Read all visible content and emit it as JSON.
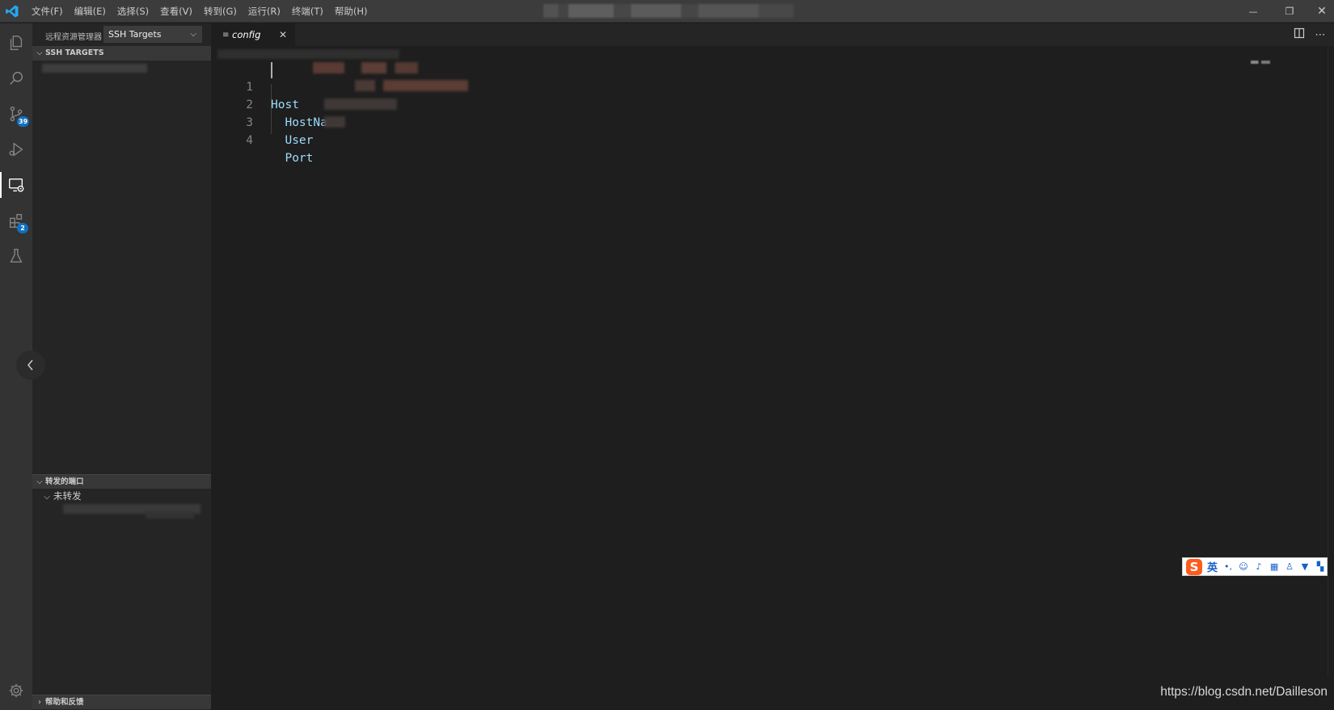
{
  "menubar": {
    "items": [
      "文件(F)",
      "编辑(E)",
      "选择(S)",
      "查看(V)",
      "转到(G)",
      "运行(R)",
      "终端(T)",
      "帮助(H)"
    ]
  },
  "window_controls": {
    "minimize": "—",
    "restore": "❐",
    "close": "✕"
  },
  "activity_bar": {
    "icons": [
      "explorer-icon",
      "search-icon",
      "source-control-icon",
      "run-debug-icon",
      "remote-explorer-icon",
      "extensions-icon",
      "testing-icon",
      "settings-gear-icon"
    ],
    "source_control_badge": "39",
    "extensions_badge": "2"
  },
  "sidebar": {
    "title": "远程资源管理器",
    "select_value": "SSH Targets",
    "ssh_targets_header": "SSH TARGETS",
    "forwarded_ports_header": "转发的端口",
    "not_forwarded_label": "未转发",
    "help_feedback_header": "帮助和反馈"
  },
  "editor": {
    "tab_label": "config",
    "tab_close": "✕",
    "lines": [
      {
        "number": "1",
        "text": "Host"
      },
      {
        "number": "2",
        "text": "  HostName"
      },
      {
        "number": "3",
        "text": "  User"
      },
      {
        "number": "4",
        "text": "  Port"
      }
    ],
    "actions": [
      "split-editor-icon",
      "more-actions-icon"
    ]
  },
  "ime_toolbar": {
    "logo": "S",
    "language": "英"
  },
  "watermark": "https://blog.csdn.net/Dailleson",
  "colors": {
    "accent": "#0e70c0",
    "keyword": "#9cdcfe",
    "editor_bg": "#1e1e1e",
    "sidebar_bg": "#252526",
    "activity_bg": "#333333",
    "titlebar_bg": "#3c3c3c"
  }
}
